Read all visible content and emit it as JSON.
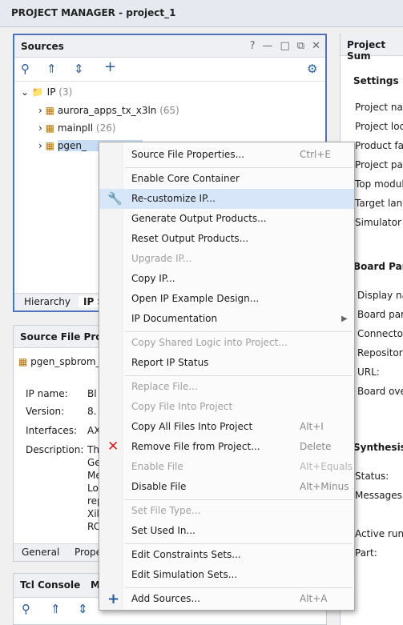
{
  "window": {
    "title": "PROJECT MANAGER - project_1"
  },
  "sources": {
    "title": "Sources",
    "header_icons": [
      "?",
      "—",
      "□",
      "⧉",
      "✕"
    ],
    "tree": {
      "root_label": "IP",
      "root_count": "(3)",
      "items": [
        {
          "label": "aurora_apps_tx_x3ln",
          "count": "(65)"
        },
        {
          "label": "mainpll",
          "count": "(26)"
        },
        {
          "label": "pgen_",
          "count": ""
        }
      ]
    },
    "tabs": [
      "Hierarchy",
      "IP S"
    ]
  },
  "properties": {
    "title": "Source File Prope",
    "file": "pgen_spbrom_",
    "rows": [
      {
        "key": "IP name:",
        "value": "Bl"
      },
      {
        "key": "Version:",
        "value": "8."
      },
      {
        "key": "Interfaces:",
        "value": "AX"
      },
      {
        "key": "Description:",
        "value": "Th"
      }
    ],
    "description_lines": [
      "Ge",
      "Me",
      "Lo",
      "rep",
      "Xil",
      "RC"
    ],
    "tabs": [
      "General",
      "Prope"
    ]
  },
  "tcl": {
    "tabs": [
      "Tcl Console",
      "M"
    ]
  },
  "right_panel": {
    "title": "Project Sum",
    "settings_header": "Settings",
    "settings_items": [
      "Project nar",
      "Project loca",
      "Product far",
      "Project par",
      "Top modul",
      "Target lang",
      "Simulator l"
    ],
    "board_header": "Board Part",
    "board_items": [
      "Display na",
      "Board part",
      "Connector",
      "Repository",
      "URL:",
      "Board over"
    ],
    "synthesis_header": "Synthesis",
    "synthesis_items": [
      "Status:",
      "Messages:",
      "Active run:",
      "Part:"
    ]
  },
  "context_menu": {
    "items": [
      {
        "label": "Source File Properties...",
        "shortcut": "Ctrl+E",
        "disabled": false
      },
      {
        "label": "Enable Core Container",
        "shortcut": "",
        "disabled": false
      },
      {
        "label": "Re-customize IP...",
        "shortcut": "",
        "disabled": false,
        "selected": true,
        "icon": "wrench-icon"
      },
      {
        "label": "Generate Output Products...",
        "shortcut": "",
        "disabled": false
      },
      {
        "label": "Reset Output Products...",
        "shortcut": "",
        "disabled": false
      },
      {
        "label": "Upgrade IP...",
        "shortcut": "",
        "disabled": true
      },
      {
        "label": "Copy IP...",
        "shortcut": "",
        "disabled": false
      },
      {
        "label": "Open IP Example Design...",
        "shortcut": "",
        "disabled": false
      },
      {
        "label": "IP Documentation",
        "shortcut": "",
        "disabled": false,
        "submenu": true
      },
      {
        "label": "Copy Shared Logic into Project...",
        "shortcut": "",
        "disabled": true
      },
      {
        "label": "Report IP Status",
        "shortcut": "",
        "disabled": false
      },
      {
        "label": "Replace File...",
        "shortcut": "",
        "disabled": true
      },
      {
        "label": "Copy File Into Project",
        "shortcut": "",
        "disabled": true
      },
      {
        "label": "Copy All Files Into Project",
        "shortcut": "Alt+I",
        "disabled": false
      },
      {
        "label": "Remove File from Project...",
        "shortcut": "Delete",
        "disabled": false,
        "icon": "red-x-icon"
      },
      {
        "label": "Enable File",
        "shortcut": "Alt+Equals",
        "disabled": true
      },
      {
        "label": "Disable File",
        "shortcut": "Alt+Minus",
        "disabled": false
      },
      {
        "label": "Set File Type...",
        "shortcut": "",
        "disabled": true
      },
      {
        "label": "Set Used In...",
        "shortcut": "",
        "disabled": false
      },
      {
        "label": "Edit Constraints Sets...",
        "shortcut": "",
        "disabled": false
      },
      {
        "label": "Edit Simulation Sets...",
        "shortcut": "",
        "disabled": false
      },
      {
        "label": "Add Sources...",
        "shortcut": "Alt+A",
        "disabled": false,
        "icon": "plus-icon"
      }
    ]
  },
  "colors": {
    "accent": "#4d74b8",
    "selected": "#d7e6f8",
    "remove": "#d42020"
  }
}
